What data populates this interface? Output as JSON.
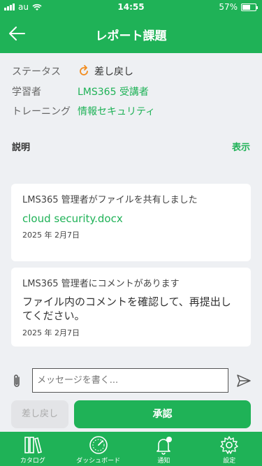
{
  "status_bar": {
    "carrier": "au",
    "time": "14:55",
    "battery": "57%"
  },
  "header": {
    "title": "レポート課題"
  },
  "info": {
    "status_label": "ステータス",
    "status_value": "差し戻し",
    "learner_label": "学習者",
    "learner_value": "LMS365 受講者",
    "training_label": "トレーニング",
    "training_value": "情報セキュリティ",
    "description_label": "説明",
    "description_show": "表示"
  },
  "messages": [
    {
      "head": "LMS365 管理者がファイルを共有しました",
      "file": "cloud security.docx",
      "date": "2025 年 2月7日"
    },
    {
      "head": "LMS365 管理者にコメントがあります",
      "body": "ファイル内のコメントを確認して、再提出してください。",
      "date": "2025 年 2月7日"
    }
  ],
  "composer": {
    "placeholder": "メッセージを書く..."
  },
  "actions": {
    "return_label": "差し戻し",
    "approve_label": "承認"
  },
  "tabbar": {
    "catalog": "カタログ",
    "dashboard": "ダッシュボード",
    "notifications": "通知",
    "settings": "設定"
  },
  "colors": {
    "brand": "#1fb257",
    "background": "#eef0f3"
  },
  "icons": [
    "signal-icon",
    "wifi-icon",
    "back-arrow-icon",
    "return-icon",
    "paperclip-icon",
    "send-icon",
    "catalog-icon",
    "dashboard-icon",
    "bell-icon",
    "gear-icon"
  ]
}
